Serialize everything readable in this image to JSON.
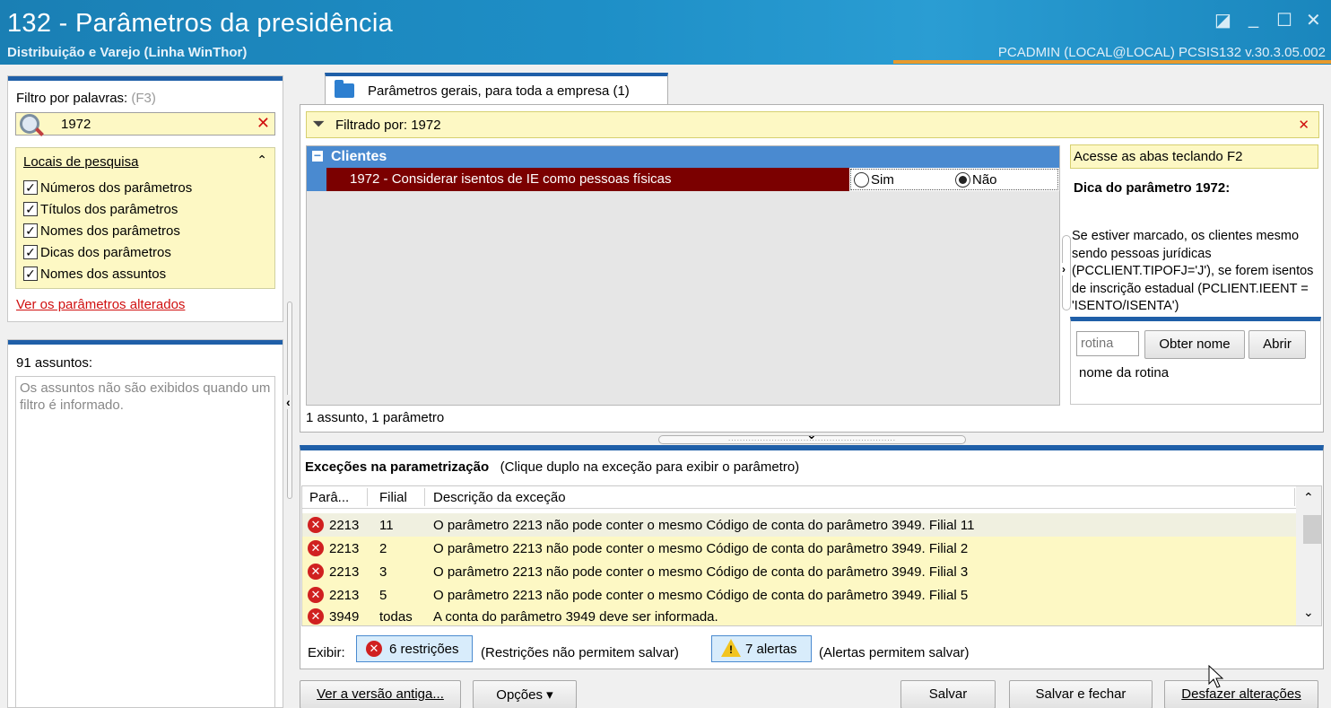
{
  "window": {
    "title": "132 - Parâmetros da presidência",
    "subtitle": "Distribuição e Varejo (Linha WinThor)",
    "user_info": "PCADMIN (LOCAL@LOCAL)   PCSIS132  v.30.3.05.002"
  },
  "filter": {
    "label": "Filtro por palavras:",
    "shortcut": "(F3)",
    "value": "1972",
    "locais_title": "Locais de pesquisa",
    "locais": [
      {
        "label": "Números dos parâmetros",
        "checked": true
      },
      {
        "label": "Títulos dos parâmetros",
        "checked": true
      },
      {
        "label": "Nomes dos parâmetros",
        "checked": true
      },
      {
        "label": "Dicas dos parâmetros",
        "checked": true
      },
      {
        "label": "Nomes dos assuntos",
        "checked": true
      }
    ],
    "changed_link": "Ver os parâmetros alterados"
  },
  "subjects": {
    "count_label": "91 assuntos:",
    "message": "Os assuntos não são exibidos quando um filtro é informado."
  },
  "tab": {
    "label": "Parâmetros gerais, para toda a empresa  (1)"
  },
  "filtered": {
    "label": "Filtrado por: 1972"
  },
  "grid": {
    "category": "Clientes",
    "row": {
      "label": "1972 - Considerar isentos de IE como pessoas físicas",
      "option_yes": "Sim",
      "option_no": "Não",
      "selected": "Não"
    },
    "summary": "1 assunto, 1 parâmetro"
  },
  "hint": {
    "access": "Acesse as abas teclando F2",
    "title": "Dica do parâmetro 1972:",
    "text": "Se estiver marcado, os clientes mesmo sendo pessoas jurídicas (PCCLIENT.TIPOFJ='J'), se forem isentos de inscrição estadual (PCLIENT.IEENT = 'ISENTO/ISENTA')"
  },
  "rotina": {
    "placeholder": "rotina",
    "get_name": "Obter nome",
    "open": "Abrir",
    "name_label": "nome da rotina"
  },
  "exceptions": {
    "title": "Exceções na parametrização",
    "note": "(Clique duplo na exceção para exibir o parâmetro)",
    "columns": [
      "Parâ...",
      "Filial",
      "Descrição da exceção"
    ],
    "rows": [
      {
        "param": "2213",
        "filial": "11",
        "desc": "O parâmetro 2213 não pode conter o mesmo Código de conta do parâmetro 3949. Filial 11"
      },
      {
        "param": "2213",
        "filial": "2",
        "desc": "O parâmetro 2213 não pode conter o mesmo Código de conta do parâmetro 3949. Filial 2"
      },
      {
        "param": "2213",
        "filial": "3",
        "desc": "O parâmetro 2213 não pode conter o mesmo Código de conta do parâmetro 3949. Filial 3"
      },
      {
        "param": "2213",
        "filial": "5",
        "desc": "O parâmetro 2213 não pode conter o mesmo Código de conta do parâmetro 3949. Filial 5"
      },
      {
        "param": "3949",
        "filial": "todas",
        "desc": "A conta do parâmetro 3949 deve ser informada."
      }
    ],
    "show_label": "Exibir:",
    "restrictions_btn": "6 restrições",
    "restrictions_note": "(Restrições não permitem salvar)",
    "alerts_btn": "7 alertas",
    "alerts_note": "(Alertas permitem salvar)"
  },
  "buttons": {
    "old_version": "Ver a versão antiga...",
    "options": "Opções ▾",
    "save": "Salvar",
    "save_close": "Salvar e fechar",
    "undo": "Desfazer alterações"
  },
  "colors": {
    "accent": "#1f5fa8",
    "selected_row": "#7b0000",
    "highlight": "#fdf8c4",
    "link": "#d01010"
  }
}
